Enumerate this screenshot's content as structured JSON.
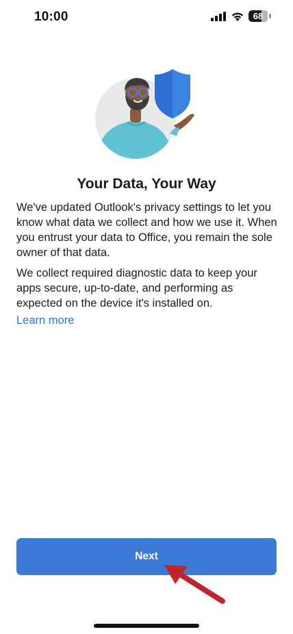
{
  "status_bar": {
    "time": "10:00",
    "battery_level": "68",
    "icons": [
      "signal-icon",
      "wifi-icon",
      "battery-icon"
    ]
  },
  "illustration": {
    "icon": "privacy-illustration",
    "elements": [
      "person-avatar",
      "shield-icon"
    ]
  },
  "content": {
    "title": "Your Data, Your Way",
    "paragraph_1": "We've updated Outlook's privacy settings to let you know what data we collect and how we use it. When you entrust your data to Office, you remain the sole owner of that data.",
    "paragraph_2": "We collect required diagnostic data to keep your apps secure, up-to-date, and performing as expected on the device it's installed on.",
    "learn_more_label": "Learn more"
  },
  "footer": {
    "next_label": "Next"
  },
  "colors": {
    "accent": "#3b7ad6",
    "link": "#2f74cf",
    "shield": "#2f6fd3",
    "annotation_arrow": "#c0252b"
  }
}
